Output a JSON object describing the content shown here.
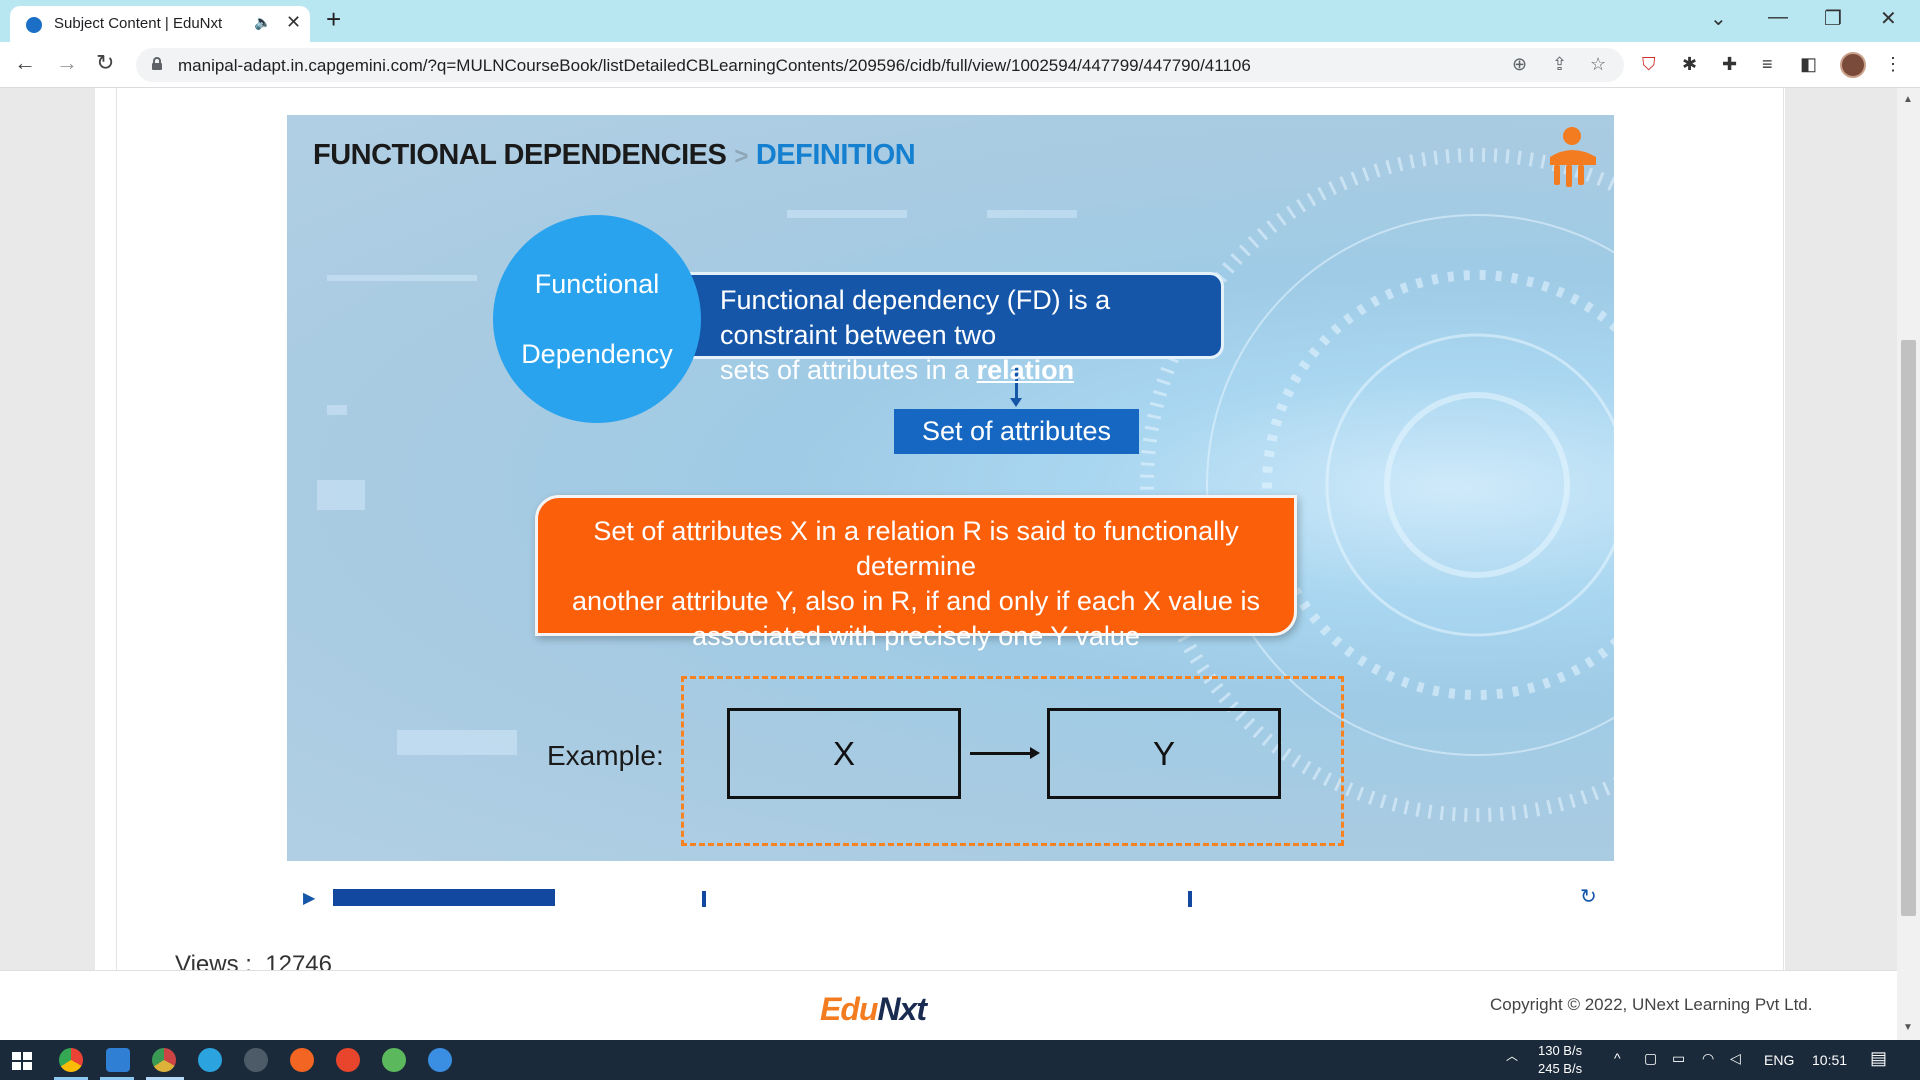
{
  "browser": {
    "tab_title": "Subject Content | EduNxt",
    "tab_audio_icon": "speaker-icon",
    "tab_close": "✕",
    "new_tab": "+",
    "url": "manipal-adapt.in.capgemini.com/?q=MULNCourseBook/listDetailedCBLearningContents/209596/cidb/full/view/1002594/447799/447790/41106"
  },
  "slide": {
    "heading_main": "FUNCTIONAL DEPENDENCIES",
    "heading_sep": ">",
    "heading_sub": "DEFINITION",
    "circle_line1": "Functional",
    "circle_line2": "Dependency",
    "fd_text_line1": "Functional dependency (FD) is a constraint between two",
    "fd_text_line2_prefix": "sets of attributes in a ",
    "fd_text_link": "relation",
    "attr_box": "Set of attributes",
    "orange_line1": "Set of attributes X in a relation R is said to functionally determine",
    "orange_line2": "another attribute Y, also in R, if and only if each X value is",
    "orange_line3": "associated with precisely one Y value",
    "example_label": "Example:",
    "x_label": "X",
    "y_label": "Y",
    "colors": {
      "circle": "#2aa3ef",
      "fd_box": "#1556a9",
      "orange_box": "#fb5f0a",
      "heading_sub": "#1580cf",
      "dashed_border": "#f7821f"
    }
  },
  "player": {
    "play_icon": "▶",
    "replay_icon": "↻",
    "progress_fraction": 0.21,
    "cue_points": [
      0.35,
      0.81
    ]
  },
  "views": {
    "label": "Views :",
    "count": "12746"
  },
  "footer": {
    "logo_part1": "Edu",
    "logo_part2": "Nxt",
    "copyright": "Copyright © 2022, UNext Learning Pvt Ltd."
  },
  "taskbar": {
    "net_up": "130 B/s",
    "net_down": "245 B/s",
    "language": "ENG",
    "time": "10:51"
  }
}
